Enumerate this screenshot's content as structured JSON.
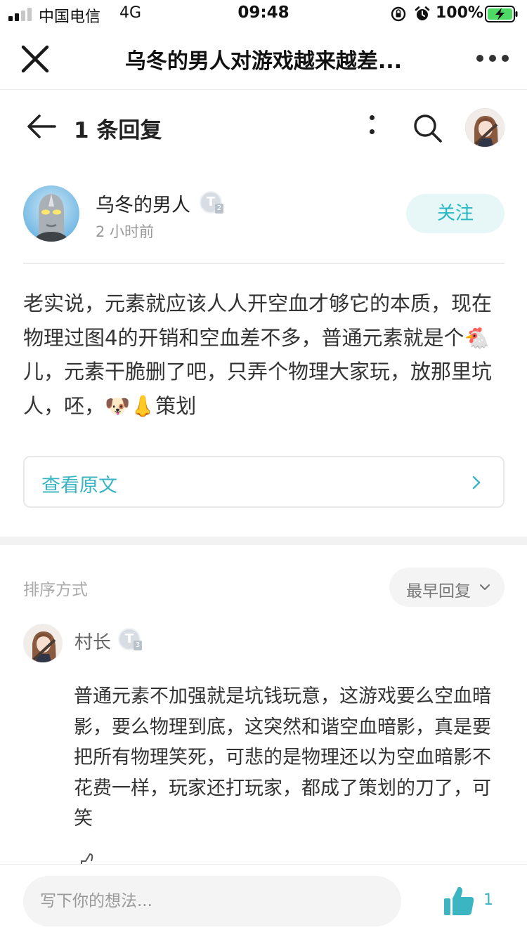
{
  "status_bar": {
    "carrier": "中国电信",
    "network": "4G",
    "time": "09:48",
    "battery": "100%"
  },
  "title_bar": {
    "title": "乌冬的男人对游戏越来越差..."
  },
  "sub_header": {
    "reply_count": "1 条回复"
  },
  "post": {
    "author": "乌冬的男人",
    "time": "2 小时前",
    "follow_label": "关注",
    "body": "老实说，元素就应该人人开空血才够它的本质，现在物理过图4的开销和空血差不多，普通元素就是个🐔儿，元素干脆删了吧，只弄个物理大家玩，放那里坑人，呸，🐶👃策划",
    "view_original": "查看原文"
  },
  "sort": {
    "label": "排序方式",
    "selected": "最早回复"
  },
  "reply": {
    "author": "村长",
    "body": "普通元素不加强就是坑钱玩意，这游戏要么空血暗影，要么物理到底，这突然和谐空血暗影，真是要把所有物理笑死，可悲的是物理还以为空血暗影不花费一样，玩家还打玩家，都成了策划的刀了，可笑"
  },
  "bottom_bar": {
    "input_placeholder": "写下你的想法...",
    "like_count": "1"
  },
  "colors": {
    "accent": "#3ab5c1",
    "follow_bg": "#e7f6f7",
    "battery_green": "#4cd964"
  },
  "icons": {
    "close": "close-icon",
    "more": "more-horizontal-icon",
    "back": "arrow-left-icon",
    "kebab": "more-vertical-icon",
    "search": "search-icon",
    "chevron_right": "chevron-right-icon",
    "chevron_down": "chevron-down-icon",
    "like": "thumbs-up-icon"
  }
}
